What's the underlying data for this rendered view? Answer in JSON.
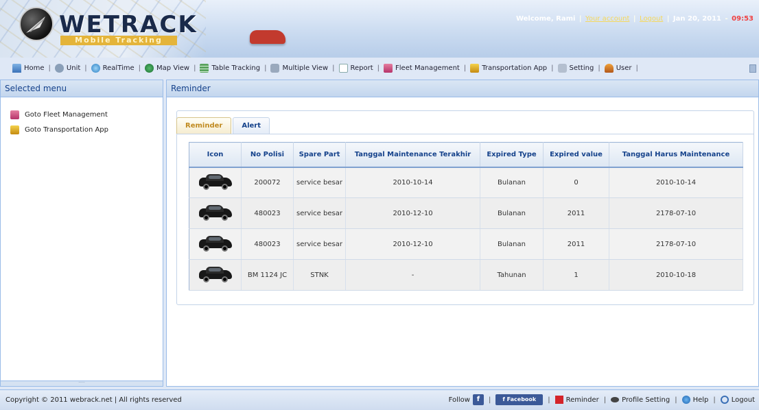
{
  "header": {
    "logo_text": "WETRACK",
    "logo_subtitle": "Mobile Tracking",
    "welcome_prefix": "Welcome, Rami",
    "your_account": "Your account",
    "logout_link": "Logout",
    "date": "Jan 20, 2011",
    "time": "09:53"
  },
  "nav": {
    "items": [
      {
        "label": "Home",
        "icon": "home-icon"
      },
      {
        "label": "Unit",
        "icon": "unit-icon"
      },
      {
        "label": "RealTime",
        "icon": "realtime-icon"
      },
      {
        "label": "Map View",
        "icon": "map-icon"
      },
      {
        "label": "Table Tracking",
        "icon": "table-icon"
      },
      {
        "label": "Multiple View",
        "icon": "multiple-view-icon"
      },
      {
        "label": "Report",
        "icon": "report-icon"
      },
      {
        "label": "Fleet Management",
        "icon": "fleet-icon"
      },
      {
        "label": "Transportation App",
        "icon": "transportation-icon"
      },
      {
        "label": "Setting",
        "icon": "setting-icon"
      },
      {
        "label": "User",
        "icon": "user-icon"
      }
    ]
  },
  "left_panel": {
    "title": "Selected menu",
    "items": [
      {
        "label": "Goto Fleet Management",
        "icon": "fleet-icon"
      },
      {
        "label": "Goto Transportation App",
        "icon": "transportation-icon"
      }
    ]
  },
  "main_panel": {
    "title": "Reminder",
    "tabs": [
      {
        "label": "Reminder",
        "active": true
      },
      {
        "label": "Alert",
        "active": false
      }
    ],
    "table": {
      "columns": [
        "Icon",
        "No Polisi",
        "Spare Part",
        "Tanggal Maintenance Terakhir",
        "Expired Type",
        "Expired value",
        "Tanggal Harus Maintenance"
      ],
      "rows": [
        {
          "icon": "car-icon",
          "no_polisi": "200072",
          "spare_part": "service besar",
          "tanggal_terakhir": "2010-10-14",
          "expired_type": "Bulanan",
          "expired_value": "0",
          "tanggal_harus": "2010-10-14"
        },
        {
          "icon": "car-icon",
          "no_polisi": "480023",
          "spare_part": "service besar",
          "tanggal_terakhir": "2010-12-10",
          "expired_type": "Bulanan",
          "expired_value": "2011",
          "tanggal_harus": "2178-07-10"
        },
        {
          "icon": "car-icon",
          "no_polisi": "480023",
          "spare_part": "service besar",
          "tanggal_terakhir": "2010-12-10",
          "expired_type": "Bulanan",
          "expired_value": "2011",
          "tanggal_harus": "2178-07-10"
        },
        {
          "icon": "car-icon",
          "no_polisi": "BM 1124 JC",
          "spare_part": "STNK",
          "tanggal_terakhir": "-",
          "expired_type": "Tahunan",
          "expired_value": "1",
          "tanggal_harus": "2010-10-18"
        }
      ]
    }
  },
  "footer": {
    "copyright": "Copyright © 2011 webrack.net | All rights reserved",
    "follow": "Follow",
    "fb_square": "f",
    "fb_button": "f  Facebook",
    "reminder": "Reminder",
    "profile_setting": "Profile Setting",
    "help": "Help",
    "logout": "Logout"
  },
  "colors": {
    "header_accent": "#15428b",
    "active_tab": "#c08a20",
    "facebook": "#3b5998",
    "time_red": "#f04040"
  }
}
